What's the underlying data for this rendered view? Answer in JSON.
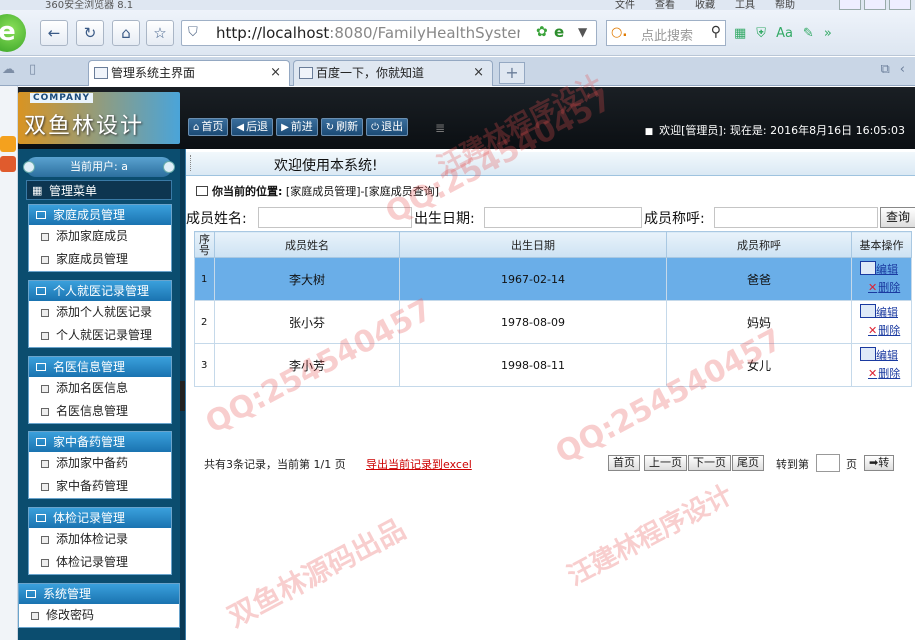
{
  "browser": {
    "title": "360安全浏览器 8.1",
    "menus": [
      "文件",
      "查看",
      "收藏",
      "工具",
      "帮助"
    ],
    "url_host": "http://localhost",
    "url_rest": ":8080/FamilyHealthSystem/lo",
    "search_placeholder": "点此搜索",
    "tabs": [
      {
        "label": "管理系统主界面",
        "active": true
      },
      {
        "label": "百度一下，你就知道",
        "active": false
      }
    ]
  },
  "app": {
    "logo_company": "COMPANY",
    "logo_name": "双鱼林设计",
    "nav": [
      {
        "icon": "home-icon",
        "glyph": "⌂",
        "label": "首页"
      },
      {
        "icon": "back-icon",
        "glyph": "◀",
        "label": "后退"
      },
      {
        "icon": "forward-icon",
        "glyph": "▶",
        "label": "前进"
      },
      {
        "icon": "refresh-icon",
        "glyph": "↻",
        "label": "刷新"
      },
      {
        "icon": "power-icon",
        "glyph": "⏻",
        "label": "退出"
      }
    ],
    "welcome_user": "欢迎[管理员]:",
    "welcome_time": "现在是: 2016年8月16日 16:05:03"
  },
  "sidebar": {
    "current_user": "当前用户: a",
    "main_menu": "管理菜单",
    "groups": [
      {
        "title": "家庭成员管理",
        "items": [
          "添加家庭成员",
          "家庭成员管理"
        ]
      },
      {
        "title": "个人就医记录管理",
        "items": [
          "添加个人就医记录",
          "个人就医记录管理"
        ]
      },
      {
        "title": "名医信息管理",
        "items": [
          "添加名医信息",
          "名医信息管理"
        ]
      },
      {
        "title": "家中备药管理",
        "items": [
          "添加家中备药",
          "家中备药管理"
        ]
      },
      {
        "title": "体检记录管理",
        "items": [
          "添加体检记录",
          "体检记录管理"
        ]
      },
      {
        "title": "系统管理",
        "items": [
          "修改密码"
        ]
      }
    ]
  },
  "content": {
    "welcome": "欢迎使用本系统!",
    "location_label": "你当前的位置:",
    "location_path": "[家庭成员管理]-[家庭成员查询]",
    "filters": {
      "name_label": "成员姓名:",
      "birth_label": "出生日期:",
      "relation_label": "成员称呼:",
      "query_button": "查询"
    },
    "table": {
      "headers": [
        "序号",
        "成员姓名",
        "出生日期",
        "成员称呼",
        "基本操作"
      ],
      "rows": [
        {
          "idx": "1",
          "name": "李大树",
          "birth": "1967-02-14",
          "relation": "爸爸"
        },
        {
          "idx": "2",
          "name": "张小芬",
          "birth": "1978-08-09",
          "relation": "妈妈"
        },
        {
          "idx": "3",
          "name": "李小芳",
          "birth": "1998-08-11",
          "relation": "女儿"
        }
      ],
      "edit_label": "编辑",
      "delete_label": "删除"
    },
    "pager": {
      "info": "共有3条记录，当前第 1/1 页",
      "export": "导出当前记录到excel",
      "first": "首页",
      "prev": "上一页",
      "next": "下一页",
      "last": "尾页",
      "goto": "转到第",
      "page_unit": "页",
      "go": "➡转"
    }
  },
  "watermark": {
    "qq": "QQ:254540457",
    "brand": "双鱼林源码出品",
    "author": "汪建林程序设计"
  }
}
